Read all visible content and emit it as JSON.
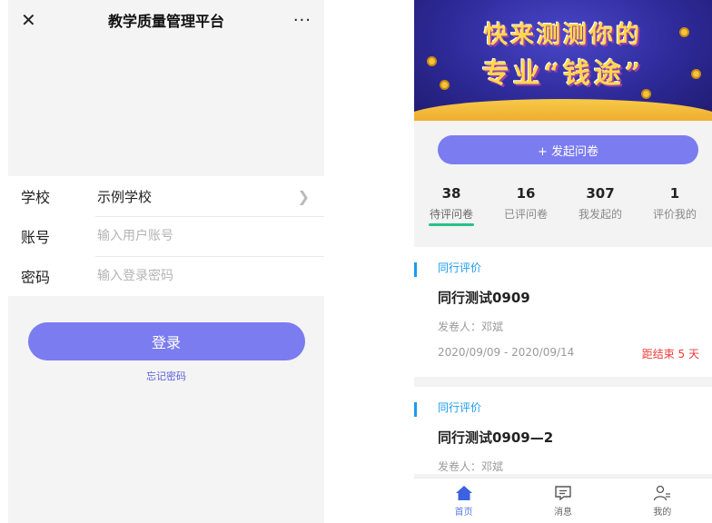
{
  "login": {
    "nav": {
      "title": "教学质量管理平台",
      "close_icon": "close-icon",
      "more_icon": "more-icon",
      "close_glyph": "✕",
      "more_glyph": "···"
    },
    "school": {
      "label": "学校",
      "value": "示例学校"
    },
    "account": {
      "label": "账号",
      "placeholder": "输入用户账号"
    },
    "password": {
      "label": "密码",
      "placeholder": "输入登录密码"
    },
    "login_button": "登录",
    "forgot_link": "忘记密码",
    "accent_color": "#7b7cef"
  },
  "survey": {
    "banner": {
      "line1": "快来测测你的",
      "line2": "专业“钱途”"
    },
    "start_button": "+ 发起问卷",
    "stats": [
      {
        "num": "38",
        "caption": "待评问卷"
      },
      {
        "num": "16",
        "caption": "已评问卷"
      },
      {
        "num": "307",
        "caption": "我发起的"
      },
      {
        "num": "1",
        "caption": "评价我的"
      }
    ],
    "cards": [
      {
        "category": "同行评价",
        "title": "同行测试0909",
        "author": "发卷人：邓斌",
        "date_range": "2020/09/09 - 2020/09/14",
        "remaining": "距结束 5 天"
      },
      {
        "category": "同行评价",
        "title": "同行测试0909—2",
        "author": "发卷人：邓斌"
      }
    ],
    "tabbar": [
      {
        "label": "首页",
        "icon": "home-icon"
      },
      {
        "label": "消息",
        "icon": "message-icon"
      },
      {
        "label": "我的",
        "icon": "profile-icon"
      }
    ],
    "colors": {
      "tab_indicator": "#28c08a",
      "category_blue": "#1b9bf0",
      "deadline_red": "#ee3b3b"
    }
  }
}
